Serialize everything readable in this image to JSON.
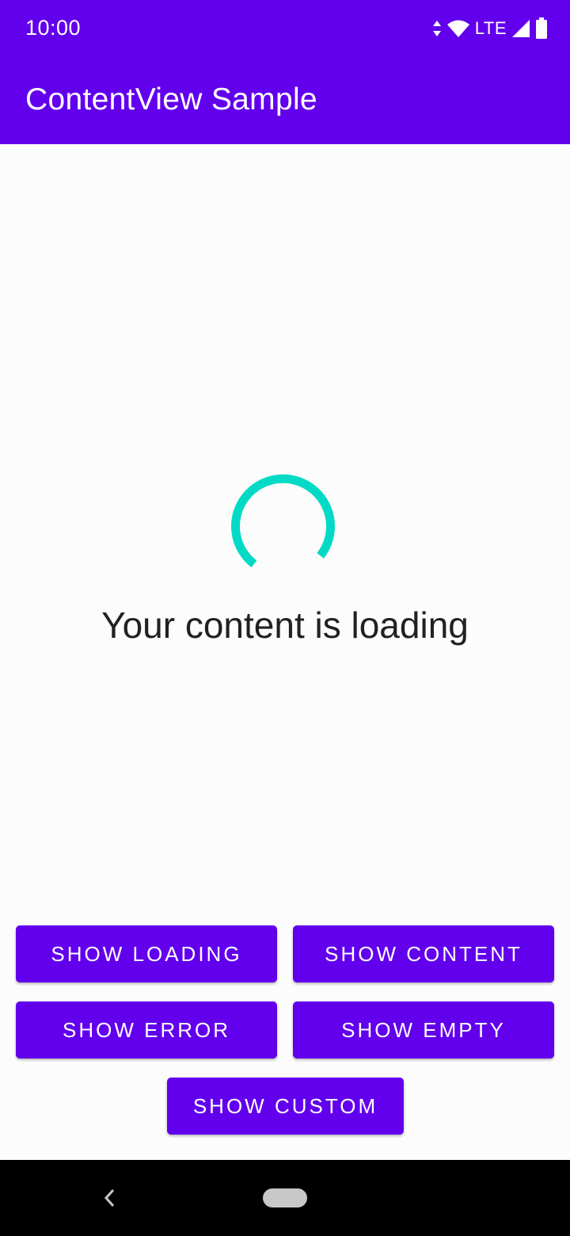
{
  "status_bar": {
    "time": "10:00",
    "network_label": "LTE",
    "icons": [
      "data-arrows-icon",
      "wifi-icon",
      "signal-icon",
      "battery-icon"
    ]
  },
  "app_bar": {
    "title": "ContentView Sample",
    "color": "#6200ee"
  },
  "content": {
    "spinner_color": "#03dac5",
    "message": "Your content is loading"
  },
  "buttons": {
    "show_loading": "SHOW LOADING",
    "show_content": "SHOW CONTENT",
    "show_error": "SHOW ERROR",
    "show_empty": "SHOW EMPTY",
    "show_custom": "SHOW CUSTOM"
  },
  "nav_bar": {
    "icons": [
      "back-icon",
      "home-pill-icon"
    ]
  }
}
